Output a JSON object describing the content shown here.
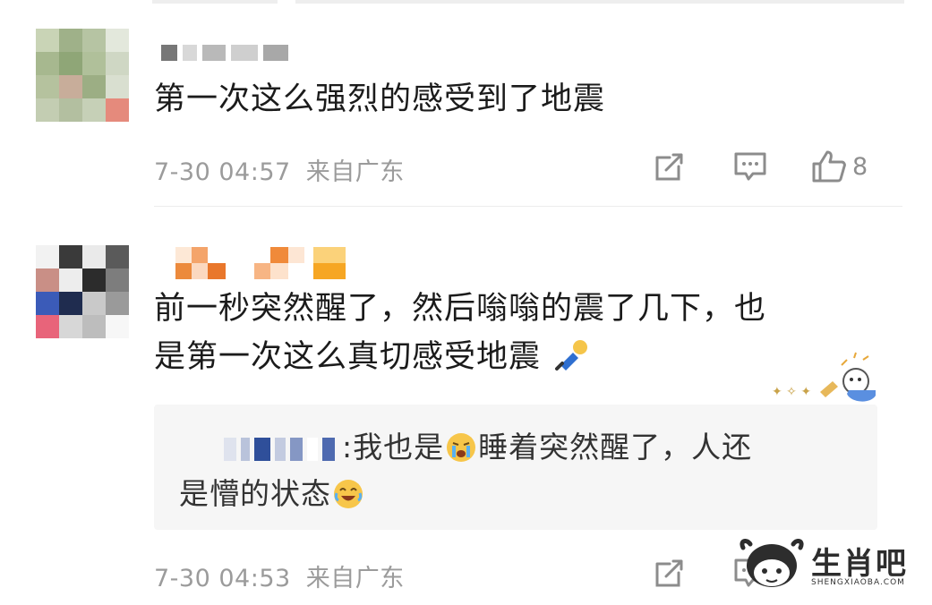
{
  "comments": [
    {
      "text": "第一次这么强烈的感受到了地震",
      "time": "7-30 04:57",
      "location": "来自广东",
      "likes": "8"
    },
    {
      "text_line1": "前一秒突然醒了，然后嗡嗡的震了几下，也",
      "text_line2": "是第一次这么真切感受地震",
      "time": "7-30 04:53",
      "location": "来自广东",
      "reply": {
        "part1": ":我也是",
        "part2": "睡着突然醒了，人还",
        "part3": "是懵的状态"
      }
    }
  ],
  "watermark": {
    "name": "生肖吧",
    "sub": "SHENGXIAOBA.COM"
  },
  "icons": {
    "share": "share-icon",
    "comment": "comment-icon",
    "like": "thumbs-up-icon",
    "emoji_fall": "falling-person-emoji-icon",
    "emoji_cry": "crying-emoji-icon",
    "emoji_laugh": "laugh-cry-emoji-icon"
  },
  "colors": {
    "text": "#1b1b1b",
    "meta": "#9b9b9b",
    "reply_bg": "#f6f6f6",
    "divider": "#ececec"
  }
}
